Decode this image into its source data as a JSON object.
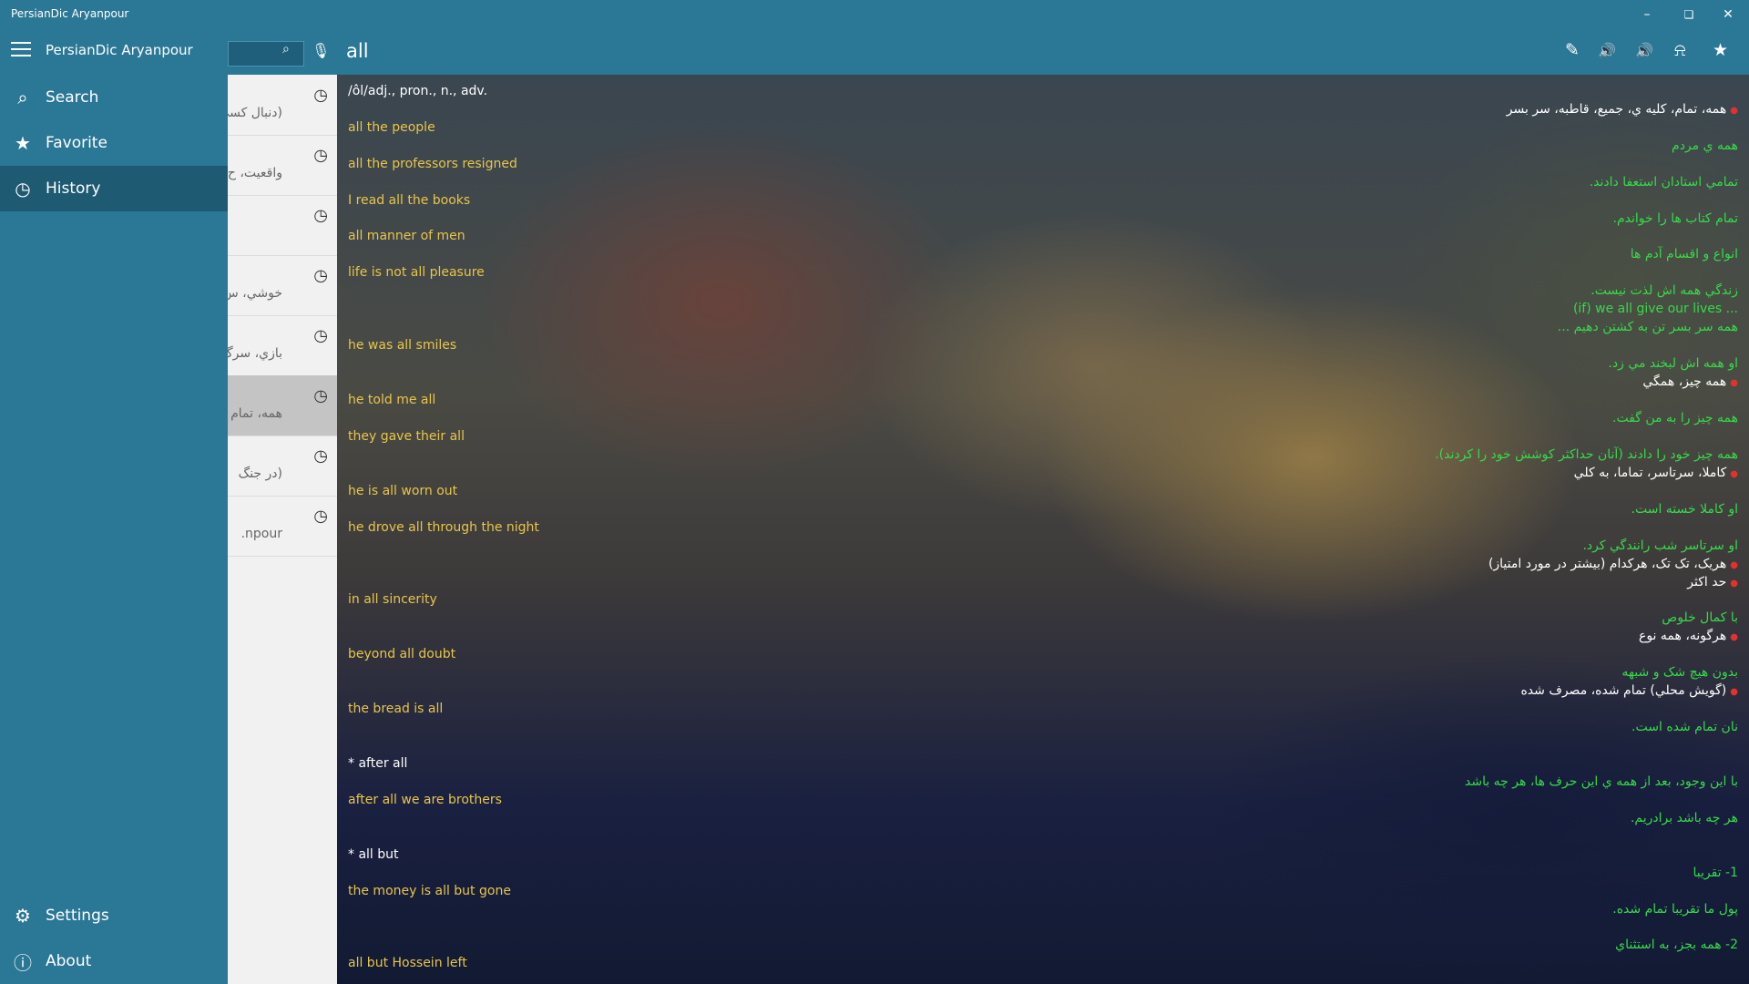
{
  "window": {
    "title": "PersianDic Aryanpour",
    "minimize": "–",
    "restore": "❏",
    "close": "✕"
  },
  "header": {
    "app_name": "PersianDic Aryanpour",
    "query": "all",
    "search_icon": "search-icon",
    "icons": [
      "pencil-icon",
      "us-flag-speaker-icon",
      "uk-flag-speaker-icon",
      "bell-icon",
      "star-icon"
    ]
  },
  "sidebar": {
    "items": [
      {
        "label": "Search",
        "icon": "search-icon"
      },
      {
        "label": "Favorite",
        "icon": "star-icon"
      },
      {
        "label": "History",
        "icon": "clock-icon"
      }
    ],
    "bottom": [
      {
        "label": "Settings",
        "icon": "gear-icon"
      },
      {
        "label": "About",
        "icon": "info-icon"
      }
    ]
  },
  "history": [
    {
      "text": "(دنبال کسي"
    },
    {
      "text": "واقعيت، ح"
    },
    {
      "text": ""
    },
    {
      "text": "خوشي، س"
    },
    {
      "text": "بازي، سرگ"
    },
    {
      "text": "همه، تمام"
    },
    {
      "text": "(در جنگ"
    },
    {
      "text": "npour."
    }
  ],
  "entry": {
    "english": [
      {
        "text": "/ôl/adj., pron., n., adv.",
        "style": "white"
      },
      {
        "text": "all the people",
        "style": "yellow"
      },
      {
        "text": "all the professors resigned",
        "style": "yellow"
      },
      {
        "text": "I read all the books",
        "style": "yellow"
      },
      {
        "text": "all manner of men",
        "style": "yellow"
      },
      {
        "text": "life is not all pleasure",
        "style": "yellow"
      },
      {
        "text": "he was all smiles",
        "style": "yellow"
      },
      {
        "text": "he told me all",
        "style": "yellow"
      },
      {
        "text": "they gave their all",
        "style": "yellow"
      },
      {
        "text": "he is all worn out",
        "style": "yellow"
      },
      {
        "text": "he drove all through the night",
        "style": "yellow"
      },
      {
        "text": "in all sincerity",
        "style": "yellow"
      },
      {
        "text": "beyond all doubt",
        "style": "yellow"
      },
      {
        "text": "the bread is all",
        "style": "yellow"
      },
      {
        "text": "* after all",
        "style": "white"
      },
      {
        "text": "after all we are brothers",
        "style": "yellow"
      },
      {
        "text": "* all but",
        "style": "white"
      },
      {
        "text": "the money is all but gone",
        "style": "yellow"
      },
      {
        "text": "all but Hossein left",
        "style": "yellow"
      }
    ],
    "persian": [
      {
        "text": "همه، تمام، کليه ي، جميع، قاطبه، سر بسر",
        "style": "white",
        "bullet": true
      },
      {
        "text": "همه ي مردم",
        "style": "green",
        "bullet": false
      },
      {
        "text": "تمامي استادان استعفا دادند.",
        "style": "green",
        "bullet": false
      },
      {
        "text": "تمام کتاب ها را خواندم.",
        "style": "green",
        "bullet": false
      },
      {
        "text": "انواع و اقسام آدم ها",
        "style": "green",
        "bullet": false
      },
      {
        "text": "زندگي همه اش لذت نيست.",
        "style": "green",
        "bullet": false
      },
      {
        "text": "(if) we all give our lives ...",
        "style": "green",
        "bullet": false
      },
      {
        "text": "همه سر بسر تن به کشتن دهيم ...",
        "style": "green",
        "bullet": false
      },
      {
        "text": "او همه اش لبخند مي زد.",
        "style": "green",
        "bullet": false
      },
      {
        "text": "همه چيز، همگي",
        "style": "white",
        "bullet": true
      },
      {
        "text": "همه چيز را به من گفت.",
        "style": "green",
        "bullet": false
      },
      {
        "text": "همه چيز خود را دادند (آنان حداکثر کوشش خود را کردند).",
        "style": "green",
        "bullet": false
      },
      {
        "text": "کاملا، سرتاسر، تماما، به کلي",
        "style": "white",
        "bullet": true
      },
      {
        "text": "او کاملا خسته است.",
        "style": "green",
        "bullet": false
      },
      {
        "text": "او سرتاسر شب رانندگي کرد.",
        "style": "green",
        "bullet": false
      },
      {
        "text": "هريک، تک تک، هرکدام (بيشتر در مورد امتياز)",
        "style": "white",
        "bullet": true
      },
      {
        "text": "حد اکثر",
        "style": "white",
        "bullet": true
      },
      {
        "text": "با کمال خلوص",
        "style": "green",
        "bullet": false
      },
      {
        "text": "هرگونه، همه نوع",
        "style": "white",
        "bullet": true
      },
      {
        "text": "بدون هيچ شک و شبهه",
        "style": "green",
        "bullet": false
      },
      {
        "text": "(گويش محلي) تمام شده، مصرف شده",
        "style": "white",
        "bullet": true
      },
      {
        "text": "نان تمام شده است.",
        "style": "green",
        "bullet": false
      },
      {
        "text": "با اين وجود، بعد از همه ي اين حرف ها، هر چه باشد",
        "style": "green",
        "bullet": false
      },
      {
        "text": "هر چه باشد برادريم.",
        "style": "green",
        "bullet": false
      },
      {
        "text": "1- تقريبا",
        "style": "green",
        "bullet": false
      },
      {
        "text": "پول ما تقريبا تمام شده.",
        "style": "green",
        "bullet": false
      },
      {
        "text": "2- همه بجز، به استثناي",
        "style": "green",
        "bullet": false
      }
    ]
  }
}
